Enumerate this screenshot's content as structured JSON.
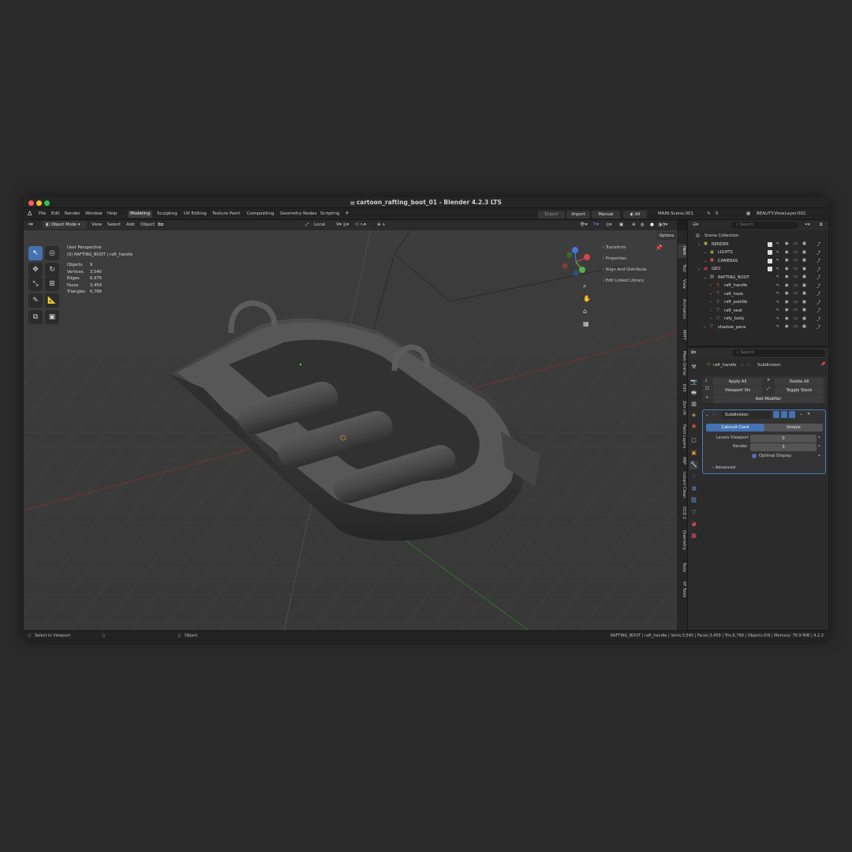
{
  "window": {
    "title": "cartoon_rafting_boot_01 - Blender 4.2.3 LTS"
  },
  "menu": {
    "items": [
      "File",
      "Edit",
      "Render",
      "Window",
      "Help"
    ]
  },
  "workspaces": [
    {
      "label": "Modeling",
      "active": true
    },
    {
      "label": "Sculpting"
    },
    {
      "label": "UV Editing"
    },
    {
      "label": "Texture Paint"
    },
    {
      "label": "Compositing"
    },
    {
      "label": "Geometry Nodes"
    },
    {
      "label": "Scripting"
    }
  ],
  "top_right": {
    "export": "Export",
    "import": "Import",
    "manual": "Manual",
    "all": "All",
    "scene": "MAIN.Scene.001",
    "scene_count": "5",
    "view_layer": "BEAUTY.ViewLayer.001"
  },
  "viewport_header": {
    "mode": "Object Mode",
    "menus": [
      "View",
      "Select",
      "Add",
      "Object"
    ],
    "orientation": "Local",
    "options": "Options"
  },
  "overlay": {
    "perspective": "User Perspective",
    "context": "(0) RAFTING_BOOT | raft_handle"
  },
  "stats": {
    "rows": [
      {
        "label": "Objects",
        "value": "9"
      },
      {
        "label": "Vertices",
        "value": "3,540"
      },
      {
        "label": "Edges",
        "value": "6,976"
      },
      {
        "label": "Faces",
        "value": "3,459"
      },
      {
        "label": "Triangles",
        "value": "6,768"
      }
    ]
  },
  "npanel": {
    "items": [
      "Transform",
      "Properties",
      "Align And Distribute",
      "Edit Linked Library"
    ]
  },
  "sidebar_tabs": [
    "Item",
    "Tool",
    "View",
    "Animation",
    "MPFT",
    "Mesh Online",
    "Edit",
    "Zen UV",
    "Paint Layers",
    "ARP",
    "Instant Clean",
    "OCD 2",
    "Quemetry",
    "Tools",
    "VF Tools"
  ],
  "outliner": {
    "search_placeholder": "Search",
    "scene_collection": "Scene Collection",
    "rows": [
      {
        "label": "RENDER",
        "depth": 1,
        "type": "collection",
        "color": "#d8c040"
      },
      {
        "label": "LIGHTS",
        "depth": 2,
        "type": "collection",
        "color": "#9ac048"
      },
      {
        "label": "CAMERAS",
        "depth": 2,
        "type": "collection",
        "color": "#e07040"
      },
      {
        "label": "GEO",
        "depth": 1,
        "type": "collection",
        "color": "#d04040"
      },
      {
        "label": "RAFTING_BOOT",
        "depth": 2,
        "type": "object",
        "color": "#bbbbbb"
      },
      {
        "label": "raft_handle",
        "depth": 3,
        "type": "mesh",
        "color": "#e08840"
      },
      {
        "label": "raft_hook",
        "depth": 3,
        "type": "mesh",
        "color": "#e08840"
      },
      {
        "label": "raft_paddle",
        "depth": 3,
        "type": "mesh",
        "color": "#e08840"
      },
      {
        "label": "raft_seat",
        "depth": 3,
        "type": "mesh",
        "color": "#e08840"
      },
      {
        "label": "rafy_body",
        "depth": 3,
        "type": "mesh",
        "color": "#e08840"
      },
      {
        "label": "shadow_pane",
        "depth": 2,
        "type": "mesh",
        "color": "#e08840"
      }
    ]
  },
  "properties": {
    "search_placeholder": "Search",
    "object": "raft_handle",
    "modifier_crumb": "Subdivision",
    "apply_all": "Apply All",
    "delete_all": "Delete All",
    "viewport_vis": "Viewport Vis",
    "toggle_stack": "Toggle Stack",
    "add_modifier": "Add Modifier",
    "modifier": {
      "name": "Subdivision",
      "algo_a": "Catmull-Clark",
      "algo_b": "Simple",
      "levels_label": "Levels Viewport",
      "levels_value": "0",
      "render_label": "Render",
      "render_value": "3",
      "optimal": "Optimal Display",
      "advanced": "Advanced"
    }
  },
  "status": {
    "left": "Select in Viewport",
    "mid": "Object",
    "right": "RAFTING_BOOT | raft_handle | Verts:3,540 | Faces:3,459 | Tris:6,768 | Objects:0/9 | Memory: 78.9 MiB | 4.2.3"
  },
  "colors": {
    "accent": "#4572b0",
    "axis_x": "#d04848",
    "axis_y": "#58b048",
    "axis_z": "#4878d8"
  }
}
